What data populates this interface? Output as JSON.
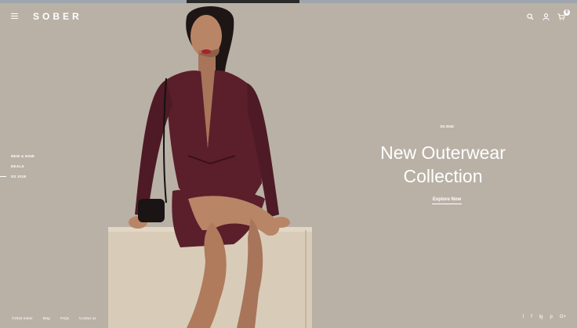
{
  "brand": {
    "logo": "SOBER"
  },
  "side_nav": {
    "items": [
      {
        "label": "NEW & NOW",
        "active": false
      },
      {
        "label": "DEALS",
        "active": false
      },
      {
        "label": "SS 2018",
        "active": true
      }
    ]
  },
  "hero": {
    "subtitle": "SS 2018",
    "title_line1": "New Outerwear",
    "title_line2": "Collection",
    "cta": "Explore Now"
  },
  "header": {
    "cart_count": "0"
  },
  "footer": {
    "links": [
      "©2018 Sober",
      "Blog",
      "FAQs",
      "Contact us"
    ]
  },
  "social": [
    "t",
    "f",
    "ig",
    "p",
    "G+"
  ],
  "icons": [
    "menu-icon",
    "search-icon",
    "user-icon",
    "cart-icon",
    "twitter-icon",
    "facebook-icon",
    "instagram-icon",
    "pinterest-icon",
    "google-plus-icon"
  ],
  "colors": {
    "background": "#b9b1a6",
    "text": "#ffffff",
    "dress": "#5a1f2b"
  }
}
